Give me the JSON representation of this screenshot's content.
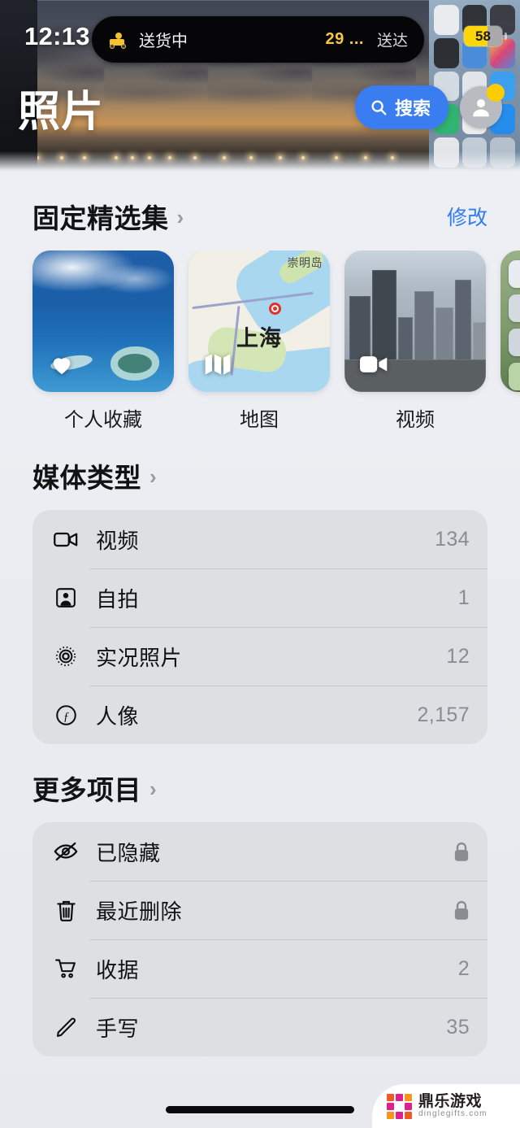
{
  "status_bar": {
    "time": "12:13",
    "island": {
      "icon": "delivery-scooter-icon",
      "title": "送货中",
      "eta": "29 ...",
      "action": "送达"
    },
    "battery": {
      "percent": "58",
      "fill_color": "#ffd60a",
      "low_power_mode": true
    }
  },
  "navbar": {
    "title": "照片",
    "search_label": "搜索",
    "search_icon": "search-icon",
    "search_color": "#3a7df0",
    "avatar_icon": "person-icon",
    "avatar_badge_color": "#ffcc00"
  },
  "sections": [
    {
      "id": "pinned-collections",
      "title": "固定精选集",
      "chevron": "›",
      "action_label": "修改",
      "action_color": "#2f7cf6",
      "items": [
        {
          "label": "个人收藏",
          "badge_icon": "heart-icon",
          "thumb": "ocean-reef"
        },
        {
          "label": "地图",
          "badge_icon": "map-icon",
          "thumb": "map",
          "map_city": "上海",
          "map_island": "崇明岛"
        },
        {
          "label": "视频",
          "badge_icon": "video-camera-icon",
          "thumb": "cityscape"
        },
        {
          "label": "",
          "badge_icon": "",
          "thumb": "app-grid"
        }
      ]
    },
    {
      "id": "media-types",
      "title": "媒体类型",
      "chevron": "›",
      "rows": [
        {
          "icon": "video-camera-icon",
          "label": "视频",
          "value": "134"
        },
        {
          "icon": "selfie-portrait-icon",
          "label": "自拍",
          "value": "1"
        },
        {
          "icon": "live-photo-icon",
          "label": "实况照片",
          "value": "12"
        },
        {
          "icon": "portrait-f-icon",
          "label": "人像",
          "value": "2,157"
        }
      ]
    },
    {
      "id": "more-items",
      "title": "更多项目",
      "chevron": "›",
      "rows": [
        {
          "icon": "eye-slash-icon",
          "label": "已隐藏",
          "value": "",
          "locked": true
        },
        {
          "icon": "trash-icon",
          "label": "最近删除",
          "value": "",
          "locked": true
        },
        {
          "icon": "cart-icon",
          "label": "收据",
          "value": "2",
          "locked": false
        },
        {
          "icon": "pencil-icon",
          "label": "手写",
          "value": "35",
          "locked": false
        }
      ]
    }
  ],
  "watermark": {
    "title": "鼎乐游戏",
    "subtitle": "dinglegifts.com"
  }
}
